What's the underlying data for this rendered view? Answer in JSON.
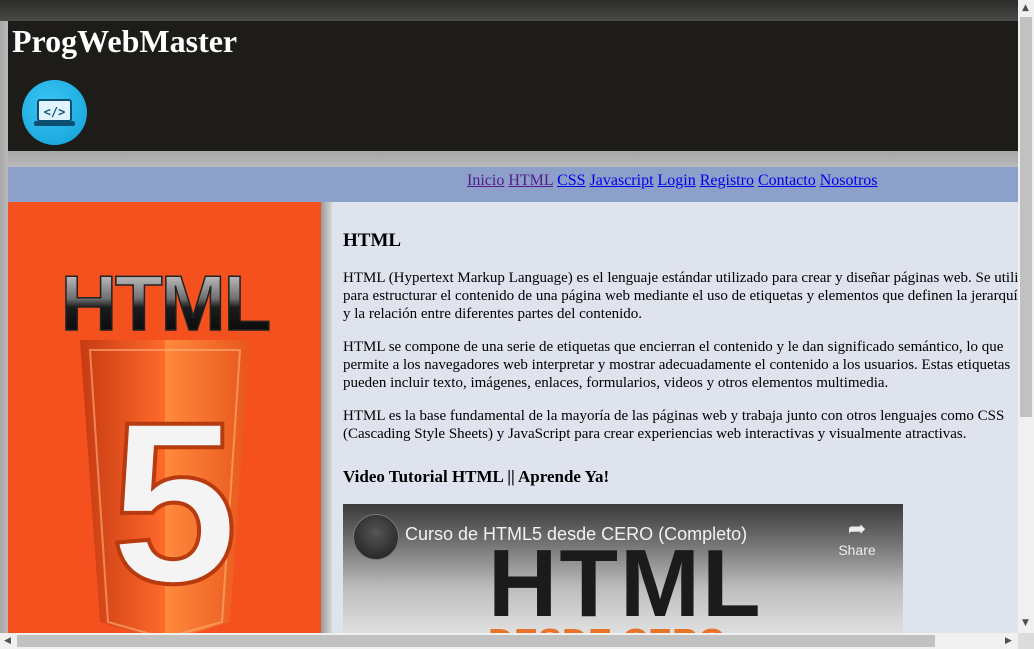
{
  "header": {
    "site_title": "ProgWebMaster",
    "logo_icon": "laptop-code-icon"
  },
  "nav": {
    "links": [
      {
        "label": "Inicio",
        "visited": true
      },
      {
        "label": "HTML",
        "visited": true
      },
      {
        "label": "CSS",
        "visited": false
      },
      {
        "label": "Javascript",
        "visited": false
      },
      {
        "label": "Login",
        "visited": false
      },
      {
        "label": "Registro",
        "visited": false
      },
      {
        "label": "Contacto",
        "visited": false
      },
      {
        "label": "Nosotros",
        "visited": false
      }
    ]
  },
  "sidebar": {
    "image_text": "HTML",
    "image_number": "5",
    "image_icon": "html5-logo-icon"
  },
  "main": {
    "heading": "HTML",
    "paragraphs": [
      [
        "HTML (Hypertext Markup Language) es el lenguaje estándar utilizado para crear y diseñar páginas web. Se utiliza",
        "para estructurar el contenido de una página web mediante el uso de etiquetas y elementos que definen la jerarquía",
        "y la relación entre diferentes partes del contenido."
      ],
      [
        "HTML se compone de una serie de etiquetas que encierran el contenido y le dan significado semántico, lo que",
        "permite a los navegadores web interpretar y mostrar adecuadamente el contenido a los usuarios. Estas etiquetas",
        "pueden incluir texto, imágenes, enlaces, formularios, videos y otros elementos multimedia."
      ],
      [
        "HTML es la base fundamental de la mayoría de las páginas web y trabaja junto con otros lenguajes como CSS",
        "(Cascading Style Sheets) y JavaScript para crear experiencias web interactivas y visualmente atractivas."
      ]
    ],
    "video_heading": "Video Tutorial HTML || Aprende Ya!",
    "video": {
      "title": "Curso de HTML5 desde CERO (Completo)",
      "share_label": "Share",
      "share_icon": "share-arrow-icon",
      "thumbnail_text": "HTML",
      "thumbnail_subtext": "DESDE CERO"
    }
  },
  "colors": {
    "header_bg": "#1e1c18",
    "nav_bg": "#8da0c9",
    "sidebar_bg": "#f4511e",
    "main_bg": "#dfe3ee"
  }
}
